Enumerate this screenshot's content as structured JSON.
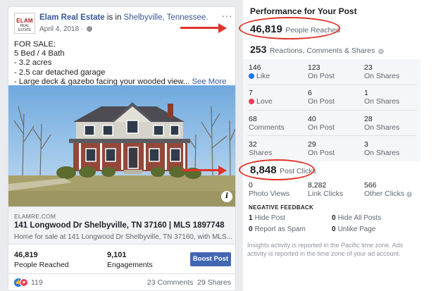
{
  "post": {
    "page_name": "Elam Real Estate",
    "is_in_text": " is in ",
    "location": "Shelbyville, Tennessee.",
    "date": "April 4, 2018 · ",
    "more_icon": "···",
    "avatar_logo_top": "ELAM",
    "avatar_logo_bottom": "REAL ESTATE",
    "text_lines": [
      "FOR SALE:",
      "5 Bed / 4 Bath",
      "- 3.2 acres",
      "- 2.5 car detached garage",
      "- Large deck & gazebo facing your wooded view..."
    ],
    "see_more": "See More",
    "photo_info": "i",
    "link": {
      "domain": "ELAMRE.COM",
      "title": "141 Longwood Dr Shelbyville, TN 37160 | MLS 1897748",
      "description": "Home for sale at 141 Longwood Dr Shelbyville, TN 37160, with MLS..."
    },
    "stats": {
      "people_reached": "46,819",
      "people_reached_label": "People Reached",
      "engagements": "9,101",
      "engagements_label": "Engagements"
    },
    "boost_label": "Boost Post",
    "reactions_count": "119",
    "comments": "23 Comments",
    "shares": "29 Shares"
  },
  "performance": {
    "title": "Performance for Your Post",
    "people_reached": "46,819",
    "people_reached_label": "People Reached",
    "reactions_total": "253",
    "reactions_total_label": "Reactions, Comments & Shares",
    "info_icon": "i",
    "grid": [
      [
        {
          "v": "146",
          "l": "Like",
          "icon": "like"
        },
        {
          "v": "123",
          "l": "On Post"
        },
        {
          "v": "23",
          "l": "On Shares"
        }
      ],
      [
        {
          "v": "7",
          "l": "Love",
          "icon": "love"
        },
        {
          "v": "6",
          "l": "On Post"
        },
        {
          "v": "1",
          "l": "On Shares"
        }
      ],
      [
        {
          "v": "68",
          "l": "Comments"
        },
        {
          "v": "40",
          "l": "On Post"
        },
        {
          "v": "28",
          "l": "On Shares"
        }
      ],
      [
        {
          "v": "32",
          "l": "Shares"
        },
        {
          "v": "29",
          "l": "On Post"
        },
        {
          "v": "3",
          "l": "On Shares"
        }
      ]
    ],
    "post_clicks": "8,848",
    "post_clicks_label": "Post Clicks",
    "clicks": [
      {
        "v": "0",
        "l": "Photo Views"
      },
      {
        "v": "8,282",
        "l": "Link Clicks"
      },
      {
        "v": "566",
        "l": "Other Clicks"
      }
    ],
    "negative_title": "NEGATIVE FEEDBACK",
    "negative": [
      {
        "v": "1",
        "l": "Hide Post"
      },
      {
        "v": "0",
        "l": "Hide All Posts"
      },
      {
        "v": "0",
        "l": "Report as Spam"
      },
      {
        "v": "0",
        "l": "Unlike Page"
      }
    ],
    "footnote": "Insights activity is reported in the Pacific time zone. Ads activity is reported in the time zone of your ad account."
  },
  "colors": {
    "fb_blue": "#4267b2",
    "link_blue": "#385898",
    "annotation_red": "#e0332a"
  }
}
